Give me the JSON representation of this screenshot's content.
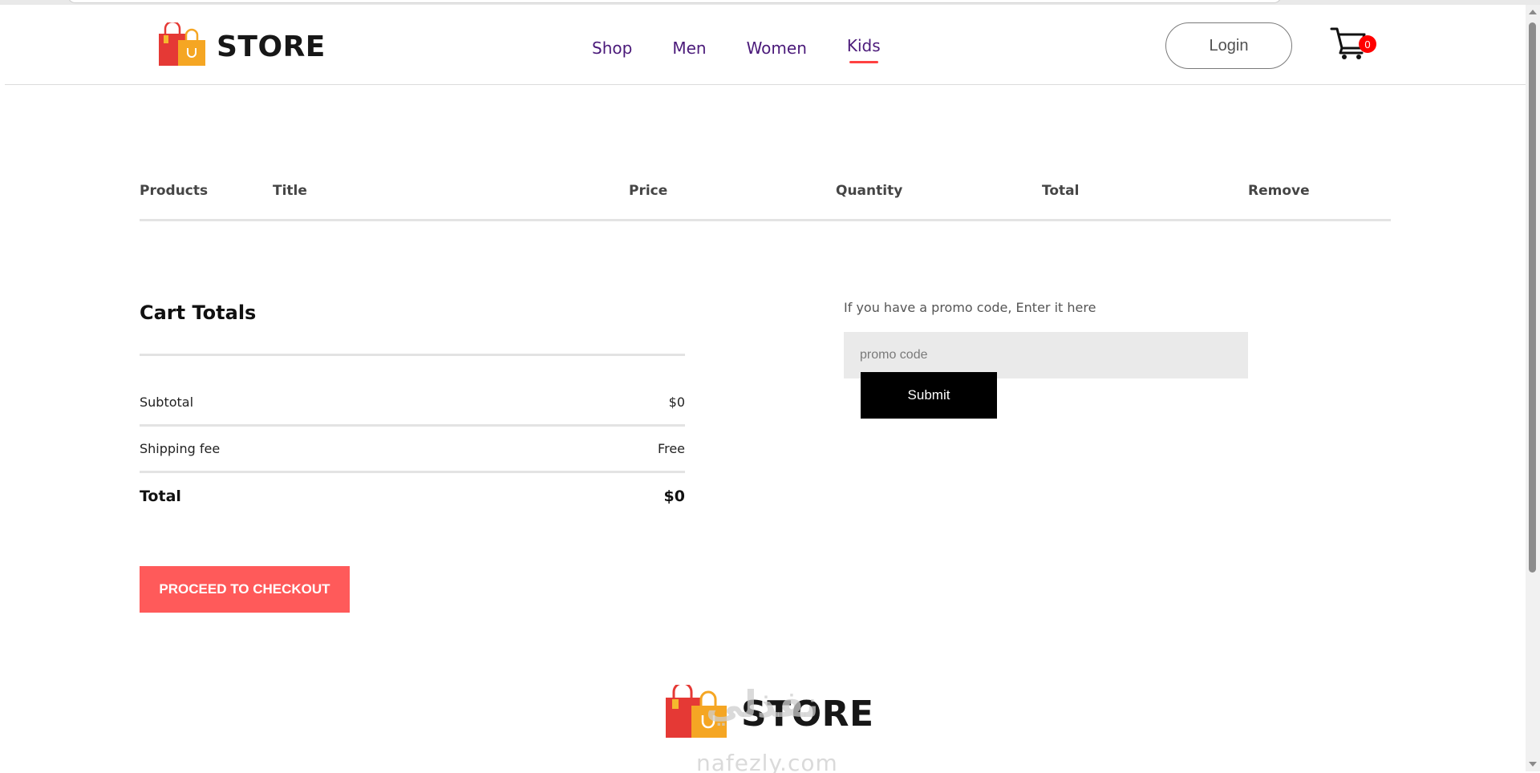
{
  "header": {
    "logo_text": "STORE",
    "nav": [
      {
        "label": "Shop",
        "active": false
      },
      {
        "label": "Men",
        "active": false
      },
      {
        "label": "Women",
        "active": false
      },
      {
        "label": "Kids",
        "active": true
      }
    ],
    "login_label": "Login",
    "cart_count": "0",
    "colors": {
      "nav_text": "#4b1a7a",
      "active_underline": "#ff4141",
      "cart_badge": "#ff0000"
    }
  },
  "cart_table": {
    "columns": [
      "Products",
      "Title",
      "Price",
      "Quantity",
      "Total",
      "Remove"
    ],
    "rows": []
  },
  "cart_totals": {
    "title": "Cart Totals",
    "rows": [
      {
        "label": "Subtotal",
        "value": "$0"
      },
      {
        "label": "Shipping fee",
        "value": "Free"
      },
      {
        "label": "Total",
        "value": "$0"
      }
    ],
    "checkout_label": "PROCEED TO CHECKOUT",
    "checkout_color": "#ff5a5a"
  },
  "promo": {
    "label": "If you have a promo code, Enter it here",
    "placeholder": "promo code",
    "submit_label": "Submit"
  },
  "footer": {
    "logo_text": "STORE",
    "watermark_top": "نفذلي",
    "watermark_bottom": "nafezly.com"
  },
  "icons": {
    "logo": "shopping-bag-icon",
    "cart": "shopping-cart-icon"
  }
}
